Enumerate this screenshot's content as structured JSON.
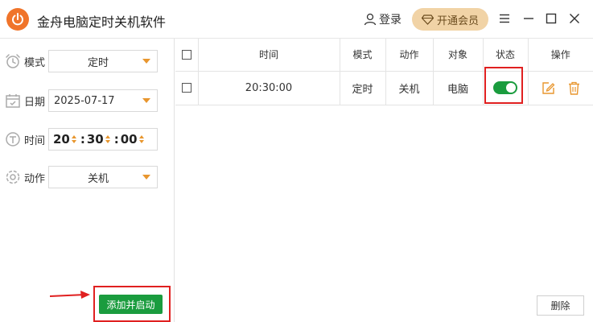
{
  "app": {
    "title": "金舟电脑定时关机软件",
    "logo_icon": "power-logo-icon",
    "accent": "#f0742a"
  },
  "header": {
    "login_label": "登录",
    "vip_label": "开通会员"
  },
  "form": {
    "mode": {
      "label": "模式",
      "value": "定时"
    },
    "date": {
      "label": "日期",
      "value": "2025-07-17"
    },
    "time": {
      "label": "时间",
      "hour": "20",
      "minute": "30",
      "second": "00"
    },
    "action": {
      "label": "动作",
      "value": "关机"
    },
    "add_button": "添加并启动"
  },
  "table": {
    "headers": {
      "time": "时间",
      "mode": "模式",
      "action": "动作",
      "target": "对象",
      "status": "状态",
      "ops": "操作"
    },
    "rows": [
      {
        "time": "20:30:00",
        "mode": "定时",
        "action": "关机",
        "target": "电脑",
        "enabled": true
      }
    ],
    "delete_button": "删除"
  },
  "colors": {
    "green": "#1a9c3e",
    "orange": "#e8962e",
    "highlight": "#e02020",
    "vip_bg": "#f1d3a6"
  }
}
